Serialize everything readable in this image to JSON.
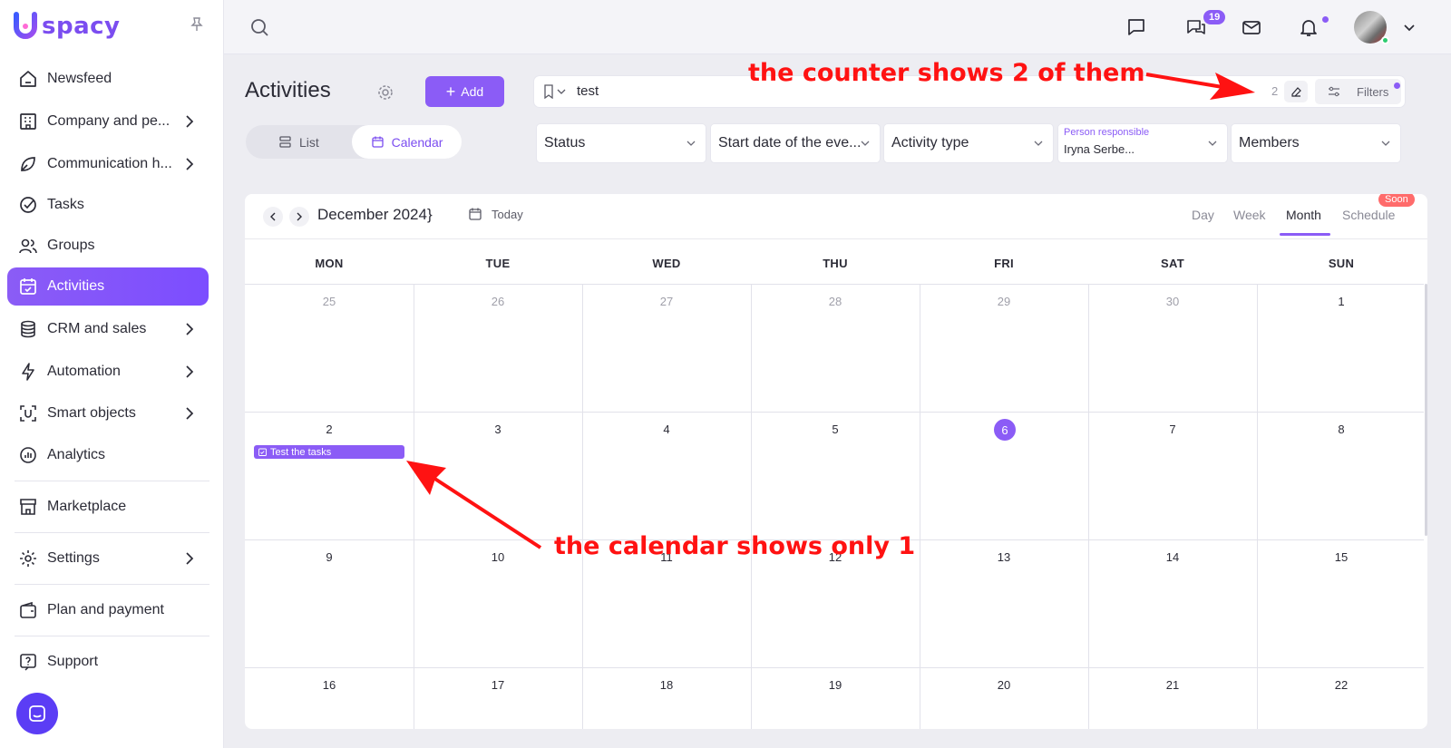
{
  "app": {
    "logo": "spacy"
  },
  "sidebar": {
    "items": [
      {
        "label": "Newsfeed"
      },
      {
        "label": "Company and pe..."
      },
      {
        "label": "Communication h..."
      },
      {
        "label": "Tasks"
      },
      {
        "label": "Groups"
      },
      {
        "label": "Activities"
      },
      {
        "label": "CRM and sales"
      },
      {
        "label": "Automation"
      },
      {
        "label": "Smart objects"
      },
      {
        "label": "Analytics"
      },
      {
        "label": "Marketplace"
      },
      {
        "label": "Settings"
      },
      {
        "label": "Plan and payment"
      },
      {
        "label": "Support"
      }
    ]
  },
  "topbar": {
    "messages_badge": "19"
  },
  "header": {
    "title": "Activities",
    "add_label": "Add",
    "view_list": "List",
    "view_calendar": "Calendar"
  },
  "search": {
    "value": "test",
    "counter": "2",
    "filters_label": "Filters"
  },
  "filters": {
    "status": "Status",
    "start_date": "Start date of the eve...",
    "activity_type": "Activity type",
    "person_label": "Person responsible",
    "person_value": "Iryna Serbe...",
    "members": "Members"
  },
  "calendar": {
    "month_title": "December 2024}",
    "today_label": "Today",
    "views": [
      "Day",
      "Week",
      "Month",
      "Schedule"
    ],
    "soon_badge": "Soon",
    "weekdays": [
      "MON",
      "TUE",
      "WED",
      "THU",
      "FRI",
      "SAT",
      "SUN"
    ],
    "weeks": [
      [
        "25",
        "26",
        "27",
        "28",
        "29",
        "30",
        "1"
      ],
      [
        "2",
        "3",
        "4",
        "5",
        "6",
        "7",
        "8"
      ],
      [
        "9",
        "10",
        "11",
        "12",
        "13",
        "14",
        "15"
      ],
      [
        "16",
        "17",
        "18",
        "19",
        "20",
        "21",
        "22"
      ]
    ],
    "event_title": "Test the tasks"
  },
  "annotations": {
    "counter_note": "the counter shows 2 of them",
    "calendar_note": "the calendar shows only 1"
  }
}
